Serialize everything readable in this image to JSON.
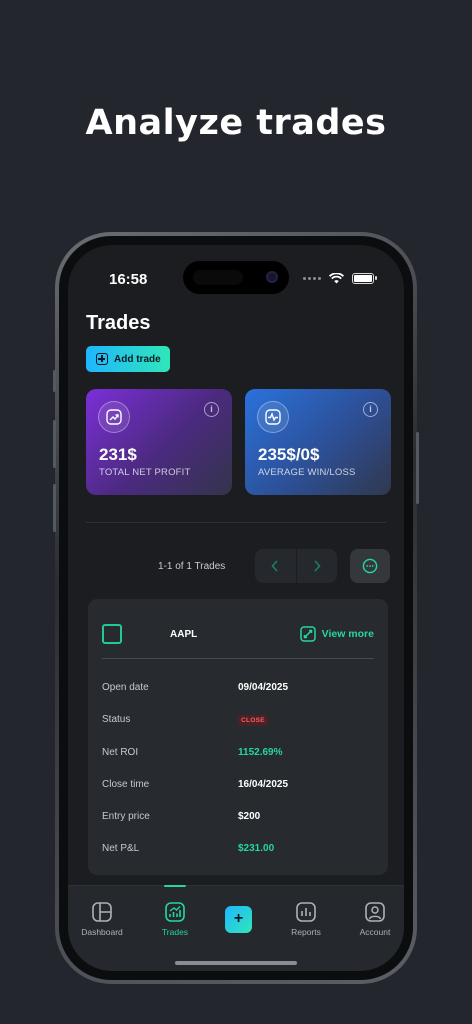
{
  "headline": "Analyze trades",
  "status_bar": {
    "time": "16:58"
  },
  "page": {
    "title": "Trades",
    "add_button": "Add trade"
  },
  "summary_cards": [
    {
      "value": "231$",
      "label": "TOTAL NET PROFIT",
      "icon": "trending-up-icon",
      "color": "#7b2fd8"
    },
    {
      "value": "235$/0$",
      "label": "AVERAGE WIN/LOSS",
      "icon": "activity-icon",
      "color": "#2a72dc"
    }
  ],
  "pagination": {
    "text": "1-1 of 1 Trades"
  },
  "trade": {
    "symbol": "AAPL",
    "view_more": "View more",
    "rows": [
      {
        "key": "Open date",
        "value": "09/04/2025"
      },
      {
        "key": "Status",
        "value": "CLOSE"
      },
      {
        "key": "Net ROI",
        "value": "1152.69%"
      },
      {
        "key": "Close time",
        "value": "16/04/2025"
      },
      {
        "key": "Entry price",
        "value": "$200"
      },
      {
        "key": "Net P&L",
        "value": "$231.00"
      }
    ]
  },
  "tabs": [
    {
      "label": "Dashboard",
      "icon": "dashboard-icon"
    },
    {
      "label": "Trades",
      "icon": "trades-icon",
      "active": true
    },
    {
      "label": "",
      "icon": "plus-icon"
    },
    {
      "label": "Reports",
      "icon": "bar-chart-icon"
    },
    {
      "label": "Account",
      "icon": "user-icon"
    }
  ],
  "colors": {
    "accent": "#25d6a2",
    "background": "#23272d",
    "status_close": "#ff5a64"
  }
}
